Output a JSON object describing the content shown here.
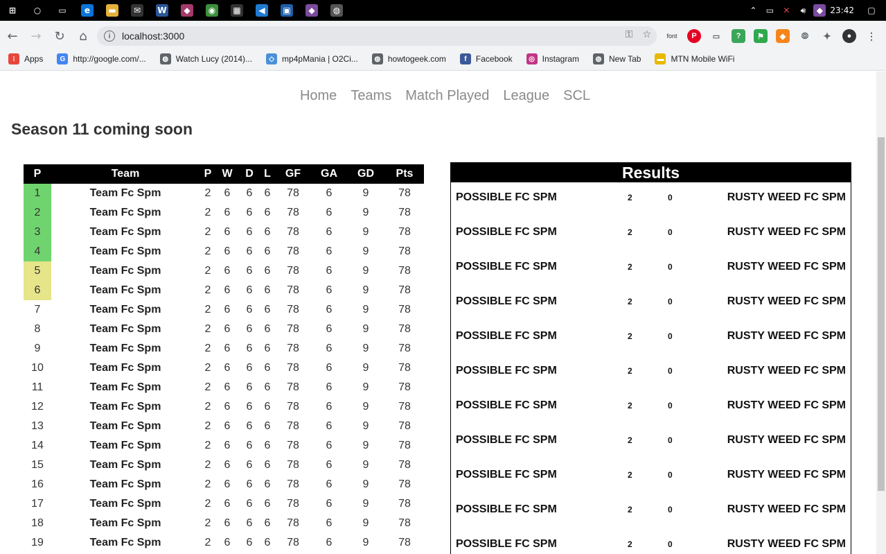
{
  "taskbar": {
    "clock": "23:42",
    "apps": [
      {
        "name": "windows-start-icon",
        "glyph": "⊞",
        "color": "#000"
      },
      {
        "name": "cortana-icon",
        "glyph": "○",
        "color": "#000"
      },
      {
        "name": "task-view-icon",
        "glyph": "▭",
        "color": "#000"
      },
      {
        "name": "edge-icon",
        "glyph": "e",
        "color": "#0a74d9"
      },
      {
        "name": "file-explorer-icon",
        "glyph": "▬",
        "color": "#e5b03a"
      },
      {
        "name": "mail-icon",
        "glyph": "✉",
        "color": "#333"
      },
      {
        "name": "word-icon",
        "glyph": "W",
        "color": "#2b5797"
      },
      {
        "name": "app-icon",
        "glyph": "◆",
        "color": "#a33a6a"
      },
      {
        "name": "chrome-icon",
        "glyph": "◉",
        "color": "#3d8f3d"
      },
      {
        "name": "store-icon",
        "glyph": "▦",
        "color": "#333"
      },
      {
        "name": "vscode-icon",
        "glyph": "◀",
        "color": "#1f7ad1"
      },
      {
        "name": "terminal-icon",
        "glyph": "▣",
        "color": "#1f5ea8"
      },
      {
        "name": "app2-icon",
        "glyph": "◆",
        "color": "#7a4b9e"
      },
      {
        "name": "photos-icon",
        "glyph": "◍",
        "color": "#555"
      }
    ]
  },
  "browser": {
    "url": "localhost:3000",
    "bookmarks": [
      {
        "label": "Apps",
        "color": "#e8453c",
        "glyph": "⁝"
      },
      {
        "label": "http://google.com/...",
        "color": "#4285f4",
        "glyph": "G"
      },
      {
        "label": "Watch Lucy (2014)...",
        "color": "#5f6368",
        "glyph": "◍"
      },
      {
        "label": "mp4pMania | O2Ci...",
        "color": "#4a90d9",
        "glyph": "◇"
      },
      {
        "label": "howtogeek.com",
        "color": "#5f6368",
        "glyph": "◍"
      },
      {
        "label": "Facebook",
        "color": "#3b5998",
        "glyph": "f"
      },
      {
        "label": "Instagram",
        "color": "#c13584",
        "glyph": "◎"
      },
      {
        "label": "New Tab",
        "color": "#5f6368",
        "glyph": "◍"
      },
      {
        "label": "MTN Mobile WiFi",
        "color": "#e8b900",
        "glyph": "▬"
      }
    ]
  },
  "nav": {
    "items": [
      "Home",
      "Teams",
      "Match Played",
      "League",
      "SCL"
    ]
  },
  "season_title": "Season 11 coming soon",
  "league": {
    "headers": [
      "P",
      "Team",
      "P",
      "W",
      "D",
      "L",
      "GF",
      "GA",
      "GD",
      "Pts"
    ],
    "rows": [
      {
        "pos": "1",
        "team": "Team Fc Spm",
        "p": "2",
        "w": "6",
        "d": "6",
        "l": "6",
        "gf": "78",
        "ga": "6",
        "gd": "9",
        "pts": "78",
        "zone": "g"
      },
      {
        "pos": "2",
        "team": "Team Fc Spm",
        "p": "2",
        "w": "6",
        "d": "6",
        "l": "6",
        "gf": "78",
        "ga": "6",
        "gd": "9",
        "pts": "78",
        "zone": "g"
      },
      {
        "pos": "3",
        "team": "Team Fc Spm",
        "p": "2",
        "w": "6",
        "d": "6",
        "l": "6",
        "gf": "78",
        "ga": "6",
        "gd": "9",
        "pts": "78",
        "zone": "g"
      },
      {
        "pos": "4",
        "team": "Team Fc Spm",
        "p": "2",
        "w": "6",
        "d": "6",
        "l": "6",
        "gf": "78",
        "ga": "6",
        "gd": "9",
        "pts": "78",
        "zone": "g"
      },
      {
        "pos": "5",
        "team": "Team Fc Spm",
        "p": "2",
        "w": "6",
        "d": "6",
        "l": "6",
        "gf": "78",
        "ga": "6",
        "gd": "9",
        "pts": "78",
        "zone": "y"
      },
      {
        "pos": "6",
        "team": "Team Fc Spm",
        "p": "2",
        "w": "6",
        "d": "6",
        "l": "6",
        "gf": "78",
        "ga": "6",
        "gd": "9",
        "pts": "78",
        "zone": "y"
      },
      {
        "pos": "7",
        "team": "Team Fc Spm",
        "p": "2",
        "w": "6",
        "d": "6",
        "l": "6",
        "gf": "78",
        "ga": "6",
        "gd": "9",
        "pts": "78",
        "zone": ""
      },
      {
        "pos": "8",
        "team": "Team Fc Spm",
        "p": "2",
        "w": "6",
        "d": "6",
        "l": "6",
        "gf": "78",
        "ga": "6",
        "gd": "9",
        "pts": "78",
        "zone": ""
      },
      {
        "pos": "9",
        "team": "Team Fc Spm",
        "p": "2",
        "w": "6",
        "d": "6",
        "l": "6",
        "gf": "78",
        "ga": "6",
        "gd": "9",
        "pts": "78",
        "zone": ""
      },
      {
        "pos": "10",
        "team": "Team Fc Spm",
        "p": "2",
        "w": "6",
        "d": "6",
        "l": "6",
        "gf": "78",
        "ga": "6",
        "gd": "9",
        "pts": "78",
        "zone": ""
      },
      {
        "pos": "11",
        "team": "Team Fc Spm",
        "p": "2",
        "w": "6",
        "d": "6",
        "l": "6",
        "gf": "78",
        "ga": "6",
        "gd": "9",
        "pts": "78",
        "zone": ""
      },
      {
        "pos": "12",
        "team": "Team Fc Spm",
        "p": "2",
        "w": "6",
        "d": "6",
        "l": "6",
        "gf": "78",
        "ga": "6",
        "gd": "9",
        "pts": "78",
        "zone": ""
      },
      {
        "pos": "13",
        "team": "Team Fc Spm",
        "p": "2",
        "w": "6",
        "d": "6",
        "l": "6",
        "gf": "78",
        "ga": "6",
        "gd": "9",
        "pts": "78",
        "zone": ""
      },
      {
        "pos": "14",
        "team": "Team Fc Spm",
        "p": "2",
        "w": "6",
        "d": "6",
        "l": "6",
        "gf": "78",
        "ga": "6",
        "gd": "9",
        "pts": "78",
        "zone": ""
      },
      {
        "pos": "15",
        "team": "Team Fc Spm",
        "p": "2",
        "w": "6",
        "d": "6",
        "l": "6",
        "gf": "78",
        "ga": "6",
        "gd": "9",
        "pts": "78",
        "zone": ""
      },
      {
        "pos": "16",
        "team": "Team Fc Spm",
        "p": "2",
        "w": "6",
        "d": "6",
        "l": "6",
        "gf": "78",
        "ga": "6",
        "gd": "9",
        "pts": "78",
        "zone": ""
      },
      {
        "pos": "17",
        "team": "Team Fc Spm",
        "p": "2",
        "w": "6",
        "d": "6",
        "l": "6",
        "gf": "78",
        "ga": "6",
        "gd": "9",
        "pts": "78",
        "zone": ""
      },
      {
        "pos": "18",
        "team": "Team Fc Spm",
        "p": "2",
        "w": "6",
        "d": "6",
        "l": "6",
        "gf": "78",
        "ga": "6",
        "gd": "9",
        "pts": "78",
        "zone": ""
      },
      {
        "pos": "19",
        "team": "Team Fc Spm",
        "p": "2",
        "w": "6",
        "d": "6",
        "l": "6",
        "gf": "78",
        "ga": "6",
        "gd": "9",
        "pts": "78",
        "zone": ""
      }
    ],
    "zone_colors": {
      "g": "#6fd46d",
      "y": "#e6e58a"
    }
  },
  "results": {
    "title": "Results",
    "matches": [
      {
        "home": "POSSIBLE FC SPM",
        "home_score": "2",
        "away_score": "0",
        "away": "RUSTY WEED FC SPM"
      },
      {
        "home": "POSSIBLE FC SPM",
        "home_score": "2",
        "away_score": "0",
        "away": "RUSTY WEED FC SPM"
      },
      {
        "home": "POSSIBLE FC SPM",
        "home_score": "2",
        "away_score": "0",
        "away": "RUSTY WEED FC SPM"
      },
      {
        "home": "POSSIBLE FC SPM",
        "home_score": "2",
        "away_score": "0",
        "away": "RUSTY WEED FC SPM"
      },
      {
        "home": "POSSIBLE FC SPM",
        "home_score": "2",
        "away_score": "0",
        "away": "RUSTY WEED FC SPM"
      },
      {
        "home": "POSSIBLE FC SPM",
        "home_score": "2",
        "away_score": "0",
        "away": "RUSTY WEED FC SPM"
      },
      {
        "home": "POSSIBLE FC SPM",
        "home_score": "2",
        "away_score": "0",
        "away": "RUSTY WEED FC SPM"
      },
      {
        "home": "POSSIBLE FC SPM",
        "home_score": "2",
        "away_score": "0",
        "away": "RUSTY WEED FC SPM"
      },
      {
        "home": "POSSIBLE FC SPM",
        "home_score": "2",
        "away_score": "0",
        "away": "RUSTY WEED FC SPM"
      },
      {
        "home": "POSSIBLE FC SPM",
        "home_score": "2",
        "away_score": "0",
        "away": "RUSTY WEED FC SPM"
      },
      {
        "home": "POSSIBLE FC SPM",
        "home_score": "2",
        "away_score": "0",
        "away": "RUSTY WEED FC SPM"
      }
    ]
  }
}
